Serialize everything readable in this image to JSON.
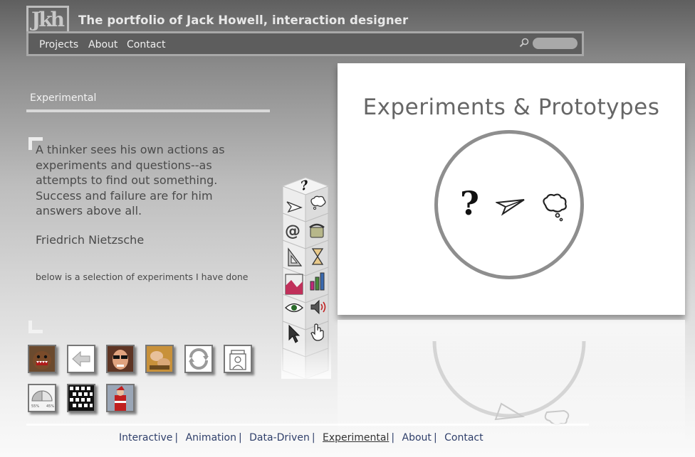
{
  "header": {
    "logo_text": "Jkh",
    "title": "The portfolio of Jack Howell, interaction designer"
  },
  "nav": {
    "items": [
      {
        "label": "Projects"
      },
      {
        "label": "About"
      },
      {
        "label": "Contact"
      }
    ],
    "search": {
      "icon": "search-icon",
      "placeholder": ""
    }
  },
  "sidebar": {
    "section_title": "Experimental",
    "quote": "A thinker sees his own actions as experiments and questions--as attempts to find out something. Success and failure are for him answers above all.",
    "quote_author": "Friedrich Nietzsche",
    "intro": "below is a selection of experiments I have done",
    "thumbnails": [
      {
        "name": "domo-thumb"
      },
      {
        "name": "back-arrow-thumb"
      },
      {
        "name": "face-sunglasses-thumb"
      },
      {
        "name": "hands-tool-thumb"
      },
      {
        "name": "rotate-arrows-thumb"
      },
      {
        "name": "jar-figure-thumb"
      },
      {
        "name": "gauge-thumb",
        "labels": [
          "55%",
          "45%"
        ]
      },
      {
        "name": "grid-pattern-thumb"
      },
      {
        "name": "santa-thumb"
      }
    ]
  },
  "slide": {
    "title": "Experiments & Prototypes",
    "icons": [
      "question-mark-icon",
      "paper-plane-icon",
      "thought-cloud-icon"
    ],
    "question_glyph": "?"
  },
  "dice": {
    "top_glyph": "?",
    "faces": [
      [
        "paper-plane-icon",
        "thought-cloud-icon"
      ],
      [
        "at-sign-icon",
        "telephone-icon"
      ],
      [
        "drafting-triangle-icon",
        "hourglass-icon"
      ],
      [
        "area-chart-icon",
        "bar-chart-icon"
      ],
      [
        "eye-icon",
        "speaker-icon"
      ],
      [
        "pointer-icon",
        "hand-cursor-icon"
      ]
    ],
    "at_glyph": "@"
  },
  "footer": {
    "links": [
      {
        "label": "Interactive"
      },
      {
        "label": "Animation"
      },
      {
        "label": "Data-Driven"
      },
      {
        "label": "Experimental",
        "active": true
      },
      {
        "label": "About"
      },
      {
        "label": "Contact"
      }
    ],
    "separator": "|"
  },
  "colors": {
    "footer_link": "#2f3f6a",
    "navbar_bg": "#5d5d5d"
  }
}
